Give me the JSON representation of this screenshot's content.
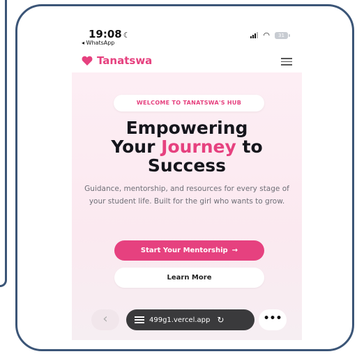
{
  "status_bar": {
    "time": "19:08",
    "back_app": "◂ WhatsApp",
    "battery": "31"
  },
  "navbar": {
    "brand": "Tanatswa"
  },
  "hero": {
    "badge": "WELCOME TO TANATSWA'S HUB",
    "headline_line1": "Empowering",
    "headline_word2": "Your",
    "headline_accent": "Journey",
    "headline_word4": "to",
    "headline_line3": "Success",
    "description": "Guidance, mentorship, and resources for every stage of your student life. Built for the girl who wants to grow.",
    "primary_button": "Start Your Mentorship",
    "secondary_button": "Learn More"
  },
  "browser_bar": {
    "url": "499g1.vercel.app"
  },
  "colors": {
    "accent": "#e6417f",
    "frame": "#3b5577"
  }
}
